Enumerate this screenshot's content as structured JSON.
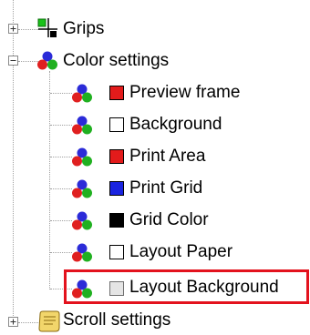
{
  "tree": {
    "grips": {
      "label": "Grips",
      "icon": "grips-icon",
      "expanded": false
    },
    "color_settings": {
      "label": "Color settings",
      "icon": "color-settings-icon",
      "expanded": true,
      "items": [
        {
          "label": "Preview frame",
          "swatch_color": "#e31b1b"
        },
        {
          "label": "Background",
          "swatch_color": "#ffffff"
        },
        {
          "label": "Print Area",
          "swatch_color": "#e31b1b"
        },
        {
          "label": "Print Grid",
          "swatch_color": "#1a24e0"
        },
        {
          "label": "Grid Color",
          "swatch_color": "#000000"
        },
        {
          "label": "Layout Paper",
          "swatch_color": "#ffffff"
        },
        {
          "label": "Layout Background",
          "swatch_color": "#e5e5e5",
          "highlighted": true
        }
      ]
    },
    "scroll_settings": {
      "label": "Scroll settings",
      "icon": "scroll-settings-icon",
      "expanded": false
    }
  },
  "colors": {
    "highlight_border": "#e3121d",
    "tree_lines": "#a0a0a0"
  }
}
